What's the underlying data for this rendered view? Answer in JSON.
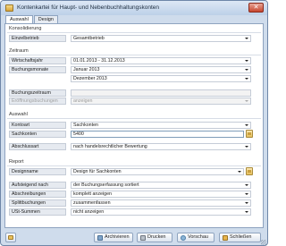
{
  "window": {
    "title": "Kontenkartei für Haupt- und Nebenbuchhaltungskonten",
    "close_glyph": "✕"
  },
  "tabs": [
    {
      "label": "Auswahl",
      "active": true
    },
    {
      "label": "Design",
      "active": false
    }
  ],
  "sections": {
    "konsolidierung": {
      "title": "Konsolidierung",
      "einzelbetrieb": {
        "label": "Einzelbetrieb",
        "value": "Gesamtbetrieb"
      }
    },
    "zeitraum": {
      "title": "Zeitraum",
      "wirtschaftsjahr": {
        "label": "Wirtschaftsjahr",
        "value": "01.01.2013 - 31.12.2013"
      },
      "buchungsmonate": {
        "label": "Buchungsmonate",
        "from": "Januar 2013",
        "to": "Dezember 2013"
      },
      "buchungszeitraum": {
        "label": "Buchungszeitraum",
        "value": ""
      },
      "eroeffnungsbuchungen": {
        "label": "Eröffnungsbuchungen",
        "value": "anzeigen"
      }
    },
    "auswahl": {
      "title": "Auswahl",
      "kontoart": {
        "label": "Kontoart",
        "value": "Sachkonten"
      },
      "sachkonten": {
        "label": "Sachkonten",
        "value": "5400"
      },
      "abschlussart": {
        "label": "Abschlussart",
        "value": "nach handelsrechtlicher Bewertung"
      }
    },
    "report": {
      "title": "Report",
      "designname": {
        "label": "Designname",
        "value": "Design für Sachkonten"
      },
      "aufsteigend": {
        "label": "Aufsteigend nach",
        "value": "der Buchungserfassung sortiert"
      },
      "abschreibungen": {
        "label": "Abschreibungen",
        "value": "komplett anzeigen"
      },
      "splittbuchungen": {
        "label": "Splittbuchungen",
        "value": "zusammenfassen"
      },
      "ust_summen": {
        "label": "USt-Summen",
        "value": "nicht anzeigen"
      }
    }
  },
  "footer": {
    "archive_label": "Archivieren",
    "print_label": "Drucken",
    "preview_label": "Vorschau",
    "close_label": "Schließen"
  },
  "colors": {
    "accent": "#cfdcec",
    "label_bg": "#e6eaf0",
    "close_button": "#c6452d"
  }
}
